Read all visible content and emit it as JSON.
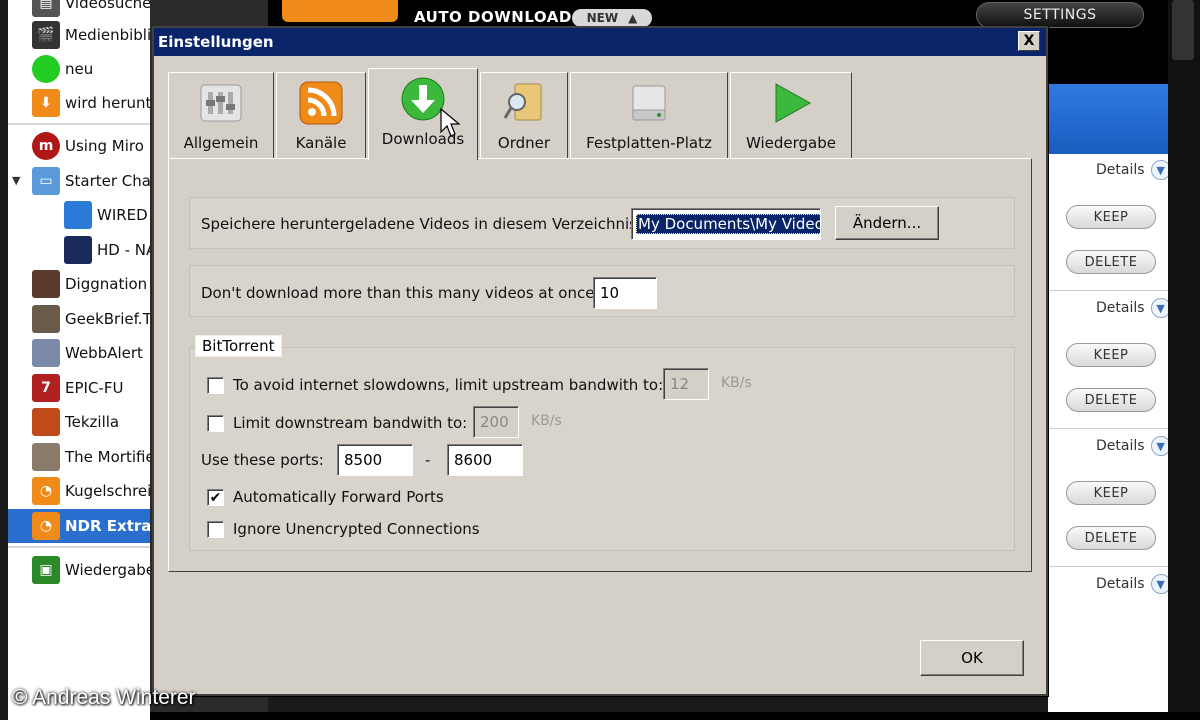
{
  "sidebar": {
    "items": [
      {
        "label": "Videosuche",
        "icon": "film-icon",
        "color": "#555555"
      },
      {
        "label": "Medienbiblio",
        "icon": "clapper-icon",
        "color": "#333333"
      },
      {
        "label": "neu",
        "icon": "star-burst-icon",
        "color": "#22cc22"
      },
      {
        "label": "wird herunte",
        "icon": "download-icon",
        "color": "#f08a18"
      },
      {
        "label": "Using Miro",
        "icon": "miro-icon",
        "color": "#b01818"
      },
      {
        "label": "Starter Cha",
        "icon": "folder-icon",
        "color": "#5a9ad8"
      },
      {
        "label": "WIRED",
        "icon": "wired-thumbnail-icon",
        "color": "#2a7ad8"
      },
      {
        "label": "HD - NA",
        "icon": "hd-thumbnail-icon",
        "color": "#1a2a5a"
      },
      {
        "label": "Diggnation",
        "icon": "diggnation-thumbnail-icon",
        "color": "#5a3a2a"
      },
      {
        "label": "GeekBrief.T",
        "icon": "geekbrief-thumbnail-icon",
        "color": "#6a5a4a"
      },
      {
        "label": "WebbAlert",
        "icon": "webbalert-thumbnail-icon",
        "color": "#7a8aa8"
      },
      {
        "label": "EPIC-FU",
        "icon": "epicfu-thumbnail-icon",
        "color": "#b02020"
      },
      {
        "label": "Tekzilla",
        "icon": "tekzilla-thumbnail-icon",
        "color": "#c04a1a"
      },
      {
        "label": "The Mortifie",
        "icon": "mortified-thumbnail-icon",
        "color": "#8a7a6a"
      },
      {
        "label": "Kugelschreib",
        "icon": "rss-icon",
        "color": "#f08a18"
      },
      {
        "label": "NDR Extra",
        "icon": "rss-icon",
        "color": "#f08a18"
      },
      {
        "label": "Wiedergabe",
        "icon": "playlist-icon",
        "color": "#2a8a2a"
      }
    ]
  },
  "topbar": {
    "auto_download": "AUTO DOWNLOAD",
    "new_badge": "NEW",
    "settings": "SETTINGS"
  },
  "background_list": {
    "details_label": "Details",
    "keep_label": "KEEP",
    "delete_label": "DELETE"
  },
  "dialog": {
    "title": "Einstellungen",
    "close": "X",
    "tabs": [
      {
        "label": "Allgemein",
        "icon": "sliders-icon"
      },
      {
        "label": "Kanäle",
        "icon": "rss-icon"
      },
      {
        "label": "Downloads",
        "icon": "download-arrow-icon",
        "active": true
      },
      {
        "label": "Ordner",
        "icon": "folder-search-icon"
      },
      {
        "label": "Festplatten-Platz",
        "icon": "hard-drive-icon"
      },
      {
        "label": "Wiedergabe",
        "icon": "play-icon"
      }
    ],
    "directory": {
      "label": "Speichere heruntergeladene Videos in diesem Verzeichnis:",
      "value": "My Documents\\My Video",
      "change_button": "Ändern..."
    },
    "max_downloads": {
      "label": "Don't download more than this many videos at once:",
      "value": "10"
    },
    "bittorrent": {
      "legend": "BitTorrent",
      "upstream": {
        "label": "To avoid internet slowdowns, limit upstream bandwith to:",
        "checked": false,
        "value": "12",
        "unit": "KB/s"
      },
      "downstream": {
        "label": "Limit downstream bandwith to:",
        "checked": false,
        "value": "200",
        "unit": "KB/s"
      },
      "ports": {
        "label": "Use these ports:",
        "from": "8500",
        "separator": "-",
        "to": "8600"
      },
      "forward_ports": {
        "label": "Automatically Forward Ports",
        "checked": true,
        "mark": "✔"
      },
      "ignore_unencrypted": {
        "label": "Ignore Unencrypted Connections",
        "checked": false
      }
    },
    "ok_button": "OK"
  },
  "copyright": "© Andreas Winterer",
  "colors": {
    "dialog_bg": "#d4d0c8",
    "titlebar": "#0a246a",
    "selection": "#2a6fd0",
    "rss_orange": "#f08a18"
  }
}
